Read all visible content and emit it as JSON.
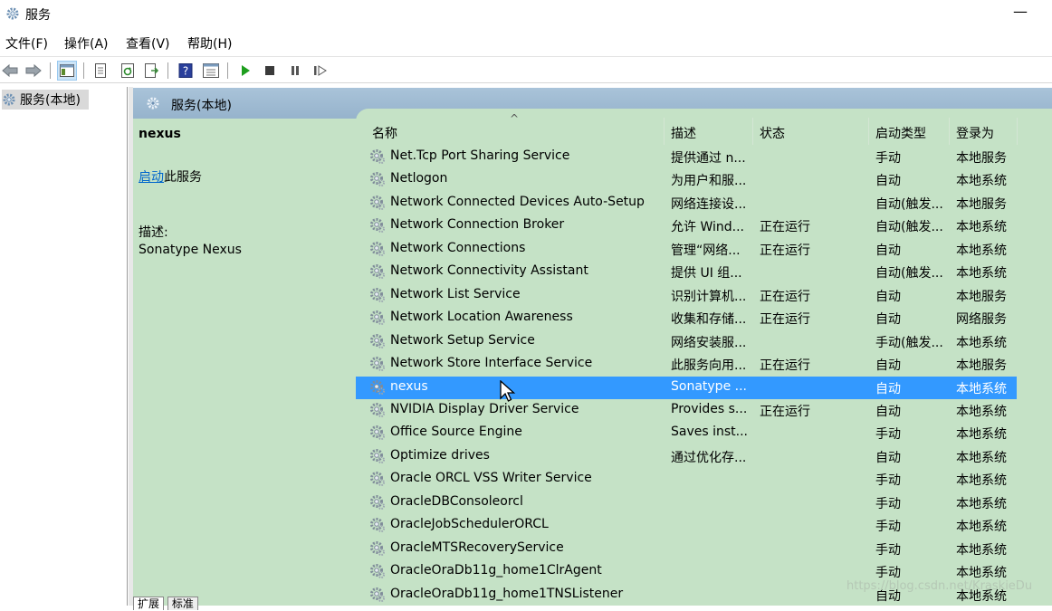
{
  "window": {
    "title": "服务",
    "minimize_glyph": "—"
  },
  "menu": [
    "文件(F)",
    "操作(A)",
    "查看(V)",
    "帮助(H)"
  ],
  "toolbar_icons": [
    "back-arrow-icon",
    "forward-arrow-icon",
    "show-hide-console-tree-icon",
    "properties-icon",
    "refresh-icon",
    "export-list-icon",
    "help-icon",
    "view-icon",
    "start-service-icon",
    "stop-service-icon",
    "pause-service-icon",
    "restart-service-icon"
  ],
  "tree": {
    "node_label": "服务(本地)"
  },
  "content_header": {
    "label": "服务(本地)"
  },
  "detail": {
    "service_name": "nexus",
    "start_link": "启动",
    "start_suffix": "此服务",
    "desc_label": "描述:",
    "desc_text": "Sonatype Nexus"
  },
  "columns": [
    "名称",
    "描述",
    "状态",
    "启动类型",
    "登录为"
  ],
  "rows": [
    [
      "Net.Tcp Port Sharing Service",
      "提供通过 n...",
      "",
      "手动",
      "本地服务"
    ],
    [
      "Netlogon",
      "为用户和服...",
      "",
      "自动",
      "本地系统"
    ],
    [
      "Network Connected Devices Auto-Setup",
      "网络连接设...",
      "",
      "自动(触发...",
      "本地服务"
    ],
    [
      "Network Connection Broker",
      "允许 Wind...",
      "正在运行",
      "自动(触发...",
      "本地系统"
    ],
    [
      "Network Connections",
      "管理“网络...",
      "正在运行",
      "自动",
      "本地系统"
    ],
    [
      "Network Connectivity Assistant",
      "提供 UI 组...",
      "",
      "自动(触发...",
      "本地系统"
    ],
    [
      "Network List Service",
      "识别计算机...",
      "正在运行",
      "自动",
      "本地服务"
    ],
    [
      "Network Location Awareness",
      "收集和存储...",
      "正在运行",
      "自动",
      "网络服务"
    ],
    [
      "Network Setup Service",
      "网络安装服...",
      "",
      "手动(触发...",
      "本地系统"
    ],
    [
      "Network Store Interface Service",
      "此服务向用...",
      "正在运行",
      "自动",
      "本地服务"
    ],
    [
      "nexus",
      "Sonatype ...",
      "",
      "自动",
      "本地系统"
    ],
    [
      "NVIDIA Display Driver Service",
      "Provides s...",
      "正在运行",
      "自动",
      "本地系统"
    ],
    [
      "Office  Source Engine",
      "Saves inst...",
      "",
      "手动",
      "本地系统"
    ],
    [
      "Optimize drives",
      "通过优化存...",
      "",
      "自动",
      "本地系统"
    ],
    [
      "Oracle ORCL VSS Writer Service",
      "",
      "",
      "手动",
      "本地系统"
    ],
    [
      "OracleDBConsoleorcl",
      "",
      "",
      "手动",
      "本地系统"
    ],
    [
      "OracleJobSchedulerORCL",
      "",
      "",
      "手动",
      "本地系统"
    ],
    [
      "OracleMTSRecoveryService",
      "",
      "",
      "手动",
      "本地系统"
    ],
    [
      "OracleOraDb11g_home1ClrAgent",
      "",
      "",
      "手动",
      "本地系统"
    ],
    [
      "OracleOraDb11g_home1TNSListener",
      "",
      "",
      "自动",
      "本地系统"
    ]
  ],
  "selected_row": 10,
  "bottom_tabs": [
    "扩展",
    "标准"
  ],
  "watermark": "https://blog.csdn.net/KraskieDu",
  "colors": {
    "list_bg": "#c5e2c6",
    "selection": "#3399ff",
    "header_bar": "#a9c3d9",
    "link": "#0066cc"
  }
}
